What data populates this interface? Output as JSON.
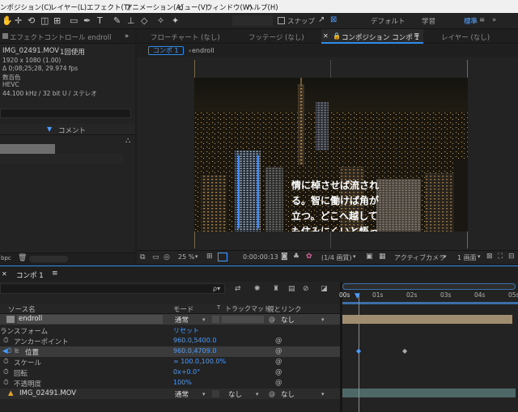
{
  "menu": [
    "ンポジション(C)",
    "レイヤー(L)",
    "エフェクト(T)",
    "アニメーション(A)",
    "ビュー(V)",
    "ウィンドウ(W)",
    "ヘルプ(H)"
  ],
  "toolbar": {
    "snap_label": "スナップ",
    "workspaces": [
      "デフォルト",
      "学習",
      "標準"
    ],
    "active_workspace": "標準"
  },
  "left_panel": {
    "tab_label": "エフェクトコントロール endroll",
    "file_name": "IMG_02491.MOV",
    "usage": "1回使用",
    "resolution": "1920 x 1080 (1.00)",
    "duration": "Δ 0;08;25;28, 29.974 fps",
    "color": "数百色",
    "codec": "HEVC",
    "audio": "44.100 kHz / 32 bit U / ステレオ",
    "comment_label": "コメント"
  },
  "comp_panel": {
    "tabs": [
      "フローチャート (なし)",
      "フッテージ (なし)",
      "コンポジション コンポ 1",
      "レイヤー (なし)"
    ],
    "breadcrumbs": [
      "コンポ 1",
      "endroll"
    ],
    "subtitle_lines": [
      "情に棹させば流され",
      "る。智に働けば角が",
      "立つ。どこへ越して",
      "も住みにくいと悟っ"
    ]
  },
  "comp_footer": {
    "zoom": "25 %",
    "timecode": "0:00:00:13",
    "resolution": "(1/4 画質)",
    "camera": "アクティブカメラ",
    "view": "1 画面"
  },
  "timeline": {
    "tab_label": "コンポ 1",
    "search_placeholder": "ρ▾",
    "col_source": "ソース名",
    "col_mode": "モード",
    "col_t": "T",
    "col_trackmatte": "トラックマット",
    "col_parent": "親とリンク",
    "layer1": {
      "name": "endroll",
      "mode": "通常",
      "parent": "なし"
    },
    "transform_label": "ランスフォーム",
    "reset_label": "リセット",
    "props": [
      {
        "name": "アンカーポイント",
        "value": "960.0,5400.0"
      },
      {
        "name": "位置",
        "value": "960.0,4709.0"
      },
      {
        "name": "スケール",
        "value": "∞ 100.0,100.0%"
      },
      {
        "name": "回転",
        "value": "0x+0.0°"
      },
      {
        "name": "不透明度",
        "value": "100%"
      }
    ],
    "layer2": {
      "name": "IMG_02491.MOV",
      "mode": "通常",
      "matte": "なし",
      "parent": "なし"
    },
    "ruler": [
      "00s",
      "01s",
      "02s",
      "03s",
      "04s",
      "05s"
    ]
  },
  "colors": {
    "accent": "#2d8ceb",
    "layer_tan": "#a08c6e",
    "layer_teal": "#4e6868"
  }
}
